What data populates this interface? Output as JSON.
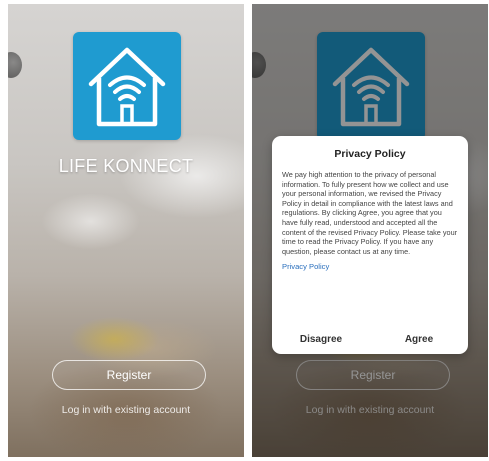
{
  "left_screen": {
    "brand": "LIFE KONNECT",
    "register_label": "Register",
    "login_link": "Log in with existing account"
  },
  "right_screen": {
    "register_label": "Register",
    "login_link": "Log in with existing account",
    "dialog": {
      "title": "Privacy Policy",
      "body": "We pay high attention to the privacy of personal information. To fully present how we collect and use your personal information, we revised the Privacy Policy in detail in compliance with the latest laws and regulations. By clicking Agree, you agree that you have fully read, understood and accepted all the content of the revised Privacy Policy. Please take your time to read the Privacy Policy. If you have any question, please contact us at any time.",
      "link": "Privacy Policy",
      "disagree_label": "Disagree",
      "agree_label": "Agree"
    }
  },
  "icons": {
    "logo": "home-wifi-icon"
  },
  "colors": {
    "brand_blue": "#1f9bd0",
    "link_blue": "#2a6fbd",
    "overlay": "rgba(0,0,0,0.42)"
  }
}
